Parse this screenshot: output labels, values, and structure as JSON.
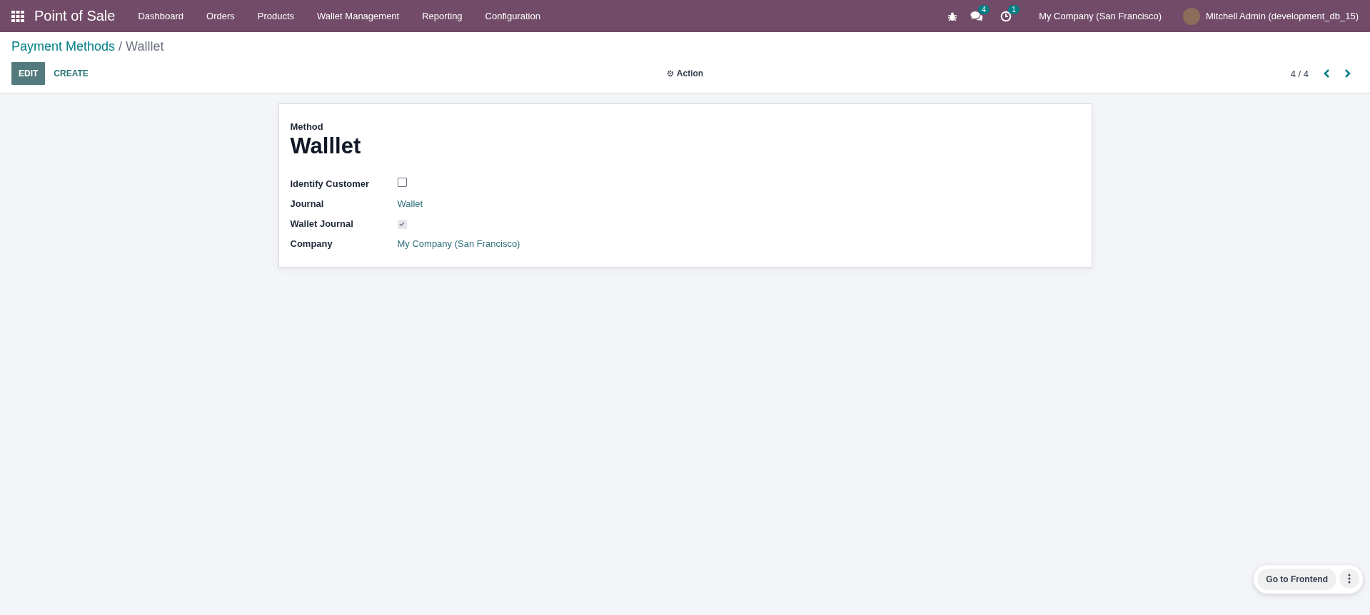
{
  "navbar": {
    "app_name": "Point of Sale",
    "menu": [
      "Dashboard",
      "Orders",
      "Products",
      "Wallet Management",
      "Reporting",
      "Configuration"
    ],
    "messages_badge": "4",
    "activities_badge": "1",
    "company": "My Company (San Francisco)",
    "user": "Mitchell Admin (development_db_15)"
  },
  "breadcrumb": {
    "parent": "Payment Methods",
    "separator": "/",
    "current": "Walllet"
  },
  "buttons": [
    "EDIT",
    "CREATE"
  ],
  "action": "Action",
  "pager": "4 / 4",
  "form": {
    "title_label": "Method",
    "title": "Walllet",
    "fields": [
      {
        "kind": "checkbox",
        "label": "Identify Customer",
        "checked": false,
        "disabled": false
      },
      {
        "kind": "link",
        "label": "Journal",
        "value": "Wallet"
      },
      {
        "kind": "checkbox",
        "label": "Wallet Journal",
        "checked": true,
        "disabled": true
      },
      {
        "kind": "link",
        "label": "Company",
        "value": "My Company (San Francisco)"
      }
    ]
  },
  "frontend_button": "Go to Frontend"
}
